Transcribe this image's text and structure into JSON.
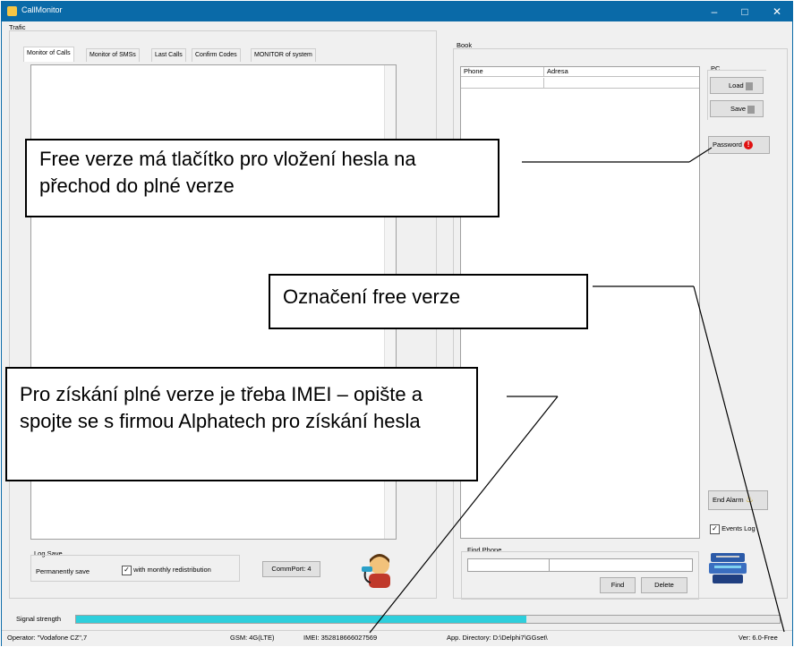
{
  "window": {
    "title": "CallMonitor"
  },
  "traffic_label": "Trafic",
  "tabs": [
    "Monitor of Calls",
    "Monitor of SMSs",
    "Last Calls",
    "Confirm Codes",
    "MONITOR of system"
  ],
  "book": {
    "label": "Book",
    "columns": [
      "Phone",
      "Adresa"
    ]
  },
  "pc": {
    "label": "PC",
    "load": "Load",
    "save": "Save",
    "password": "Password"
  },
  "log_save": {
    "label": "Log Save",
    "permanent": "Permanently save",
    "monthly": "with monthly redistribution",
    "commport": "CommPort: 4"
  },
  "find_phone": {
    "label": "Find Phone",
    "find": "Find",
    "delete": "Delete"
  },
  "end_alarm": "End Alarm",
  "events_log": "Events Log",
  "signal": {
    "label": "Signal strength",
    "level": 0.64
  },
  "status": {
    "operator": "Operator: \"Vodafone CZ\",7",
    "gsm": "GSM: 4G(LTE)",
    "imei": "IMEI: 352818666027569",
    "app_dir": "App. Directory: D:\\Delphi7\\GGset\\",
    "version": "Ver: 6.0-Free"
  },
  "callouts": {
    "free_password": "Free verze má tlačítko pro vložení hesla na přechod do plné verze",
    "free_mark": "Označení free verze",
    "imei_note": "Pro získání plné verze je třeba IMEI – opište a spojte se s firmou Alphatech pro získání hesla"
  },
  "colors": {
    "titlebar": "#0a6aa8",
    "signal_bar": "#2ecfdc",
    "alert": "#e01010"
  }
}
